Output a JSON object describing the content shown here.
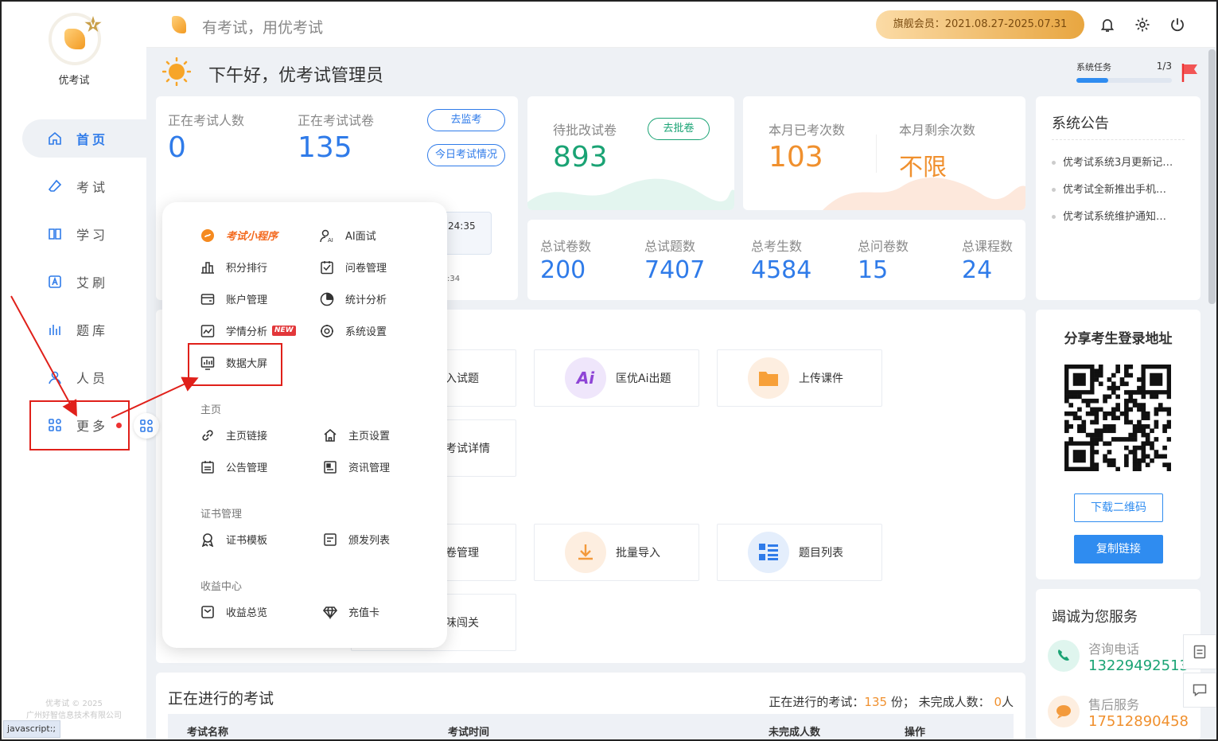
{
  "sidebar": {
    "logo_text": "优考试",
    "logo_badge": "V",
    "nav": [
      {
        "label": "首页",
        "icon": "home-icon",
        "active": true
      },
      {
        "label": "考试",
        "icon": "eraser-icon"
      },
      {
        "label": "学习",
        "icon": "book-icon"
      },
      {
        "label": "艾刷",
        "icon": "letter-a-icon"
      },
      {
        "label": "题库",
        "icon": "bars-icon"
      },
      {
        "label": "人员",
        "icon": "user-icon"
      },
      {
        "label": "更多",
        "icon": "apps-icon"
      }
    ],
    "copyright_line1": "优考试 © 2025",
    "copyright_line2": "广州好智信息技术有限公司",
    "status_text": "javascript:;"
  },
  "topbar": {
    "slogan": "有考试，用优考试",
    "vip": "旗舰会员：2021.08.27-2025.07.31",
    "icons": [
      "bell-icon",
      "gear-icon",
      "power-icon"
    ]
  },
  "greeting": {
    "text": "下午好，优考试管理员"
  },
  "task": {
    "label": "系统任务",
    "count": "1/3",
    "progress": 0.33
  },
  "exam_live": {
    "people_label": "正在考试人数",
    "people": "0",
    "papers_label": "正在考试试卷",
    "papers": "135",
    "monitor_btn": "去监考",
    "today_btn": "今日考试情况",
    "time1": "24:35",
    "time2": ":34"
  },
  "grading": {
    "label": "待批改试卷",
    "value": "893",
    "btn": "去批卷"
  },
  "month": {
    "done_label": "本月已考次数",
    "done": "103",
    "left_label": "本月剩余次数",
    "left": "不限"
  },
  "totals": [
    {
      "label": "总试卷数",
      "value": "200"
    },
    {
      "label": "总试题数",
      "value": "7407"
    },
    {
      "label": "总考生数",
      "value": "4584"
    },
    {
      "label": "总问卷数",
      "value": "15"
    },
    {
      "label": "总课程数",
      "value": "24"
    }
  ],
  "notice": {
    "title": "系统公告",
    "items": [
      "优考试系统3月更新记…",
      "优考试全新推出手机…",
      "优考试系统维护通知…"
    ]
  },
  "quick": {
    "partial": [
      "入试题",
      "考试详情",
      "卷管理",
      "味闯关"
    ],
    "tiles": [
      {
        "label": "匡优Ai出题",
        "icon": "ai-icon"
      },
      {
        "label": "上传课件",
        "icon": "folder-icon"
      },
      {
        "label": "批量导入",
        "icon": "download-icon"
      },
      {
        "label": "题目列表",
        "icon": "list-icon"
      }
    ]
  },
  "share": {
    "title": "分享考生登录地址",
    "download_btn": "下载二维码",
    "copy_btn": "复制链接"
  },
  "service": {
    "title": "竭诚为您服务",
    "phone_label": "咨询电话",
    "phone": "13229492513",
    "after_label": "售后服务",
    "after": "17512890458"
  },
  "ongoing": {
    "title": "正在进行的考试",
    "summary_prefix": "正在进行的考试：",
    "count": "135",
    "unit1": "份；",
    "unfinished_prefix": "未完成人数：",
    "unfinished": "0",
    "unit2": "人",
    "columns": [
      "考试名称",
      "考试时间",
      "未完成人数",
      "操作"
    ]
  },
  "popup": {
    "mini_program": "考试小程序",
    "grid1": [
      {
        "label": "AI面试",
        "icon": "ai-interview-icon"
      },
      {
        "label": "积分排行",
        "icon": "ranking-icon"
      },
      {
        "label": "问卷管理",
        "icon": "survey-icon"
      },
      {
        "label": "账户管理",
        "icon": "account-icon"
      },
      {
        "label": "统计分析",
        "icon": "pie-chart-icon"
      },
      {
        "label": "学情分析",
        "icon": "analysis-icon",
        "badge": "NEW"
      },
      {
        "label": "系统设置",
        "icon": "settings-icon"
      },
      {
        "label": "数据大屏",
        "icon": "dashboard-icon"
      }
    ],
    "sections": [
      {
        "title": "主页",
        "items": [
          {
            "label": "主页链接",
            "icon": "link-icon"
          },
          {
            "label": "主页设置",
            "icon": "house-icon"
          },
          {
            "label": "公告管理",
            "icon": "notice-icon"
          },
          {
            "label": "资讯管理",
            "icon": "news-icon"
          }
        ]
      },
      {
        "title": "证书管理",
        "items": [
          {
            "label": "证书模板",
            "icon": "medal-icon"
          },
          {
            "label": "颁发列表",
            "icon": "issue-list-icon"
          }
        ]
      },
      {
        "title": "收益中心",
        "items": [
          {
            "label": "收益总览",
            "icon": "wallet-icon"
          },
          {
            "label": "充值卡",
            "icon": "diamond-icon"
          }
        ]
      }
    ]
  },
  "colors": {
    "primary": "#2f7be9",
    "green": "#1aa374",
    "orange": "#f0902e",
    "annotation_red": "#e0201a"
  }
}
